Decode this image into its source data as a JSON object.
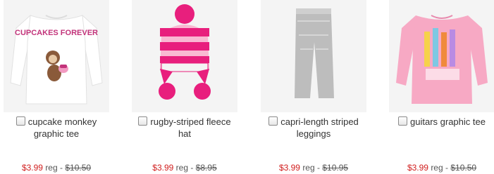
{
  "products": [
    {
      "name": "cupcake monkey graphic tee",
      "sale_price": "$3.99",
      "reg_label": "reg -",
      "reg_price": "$10.50",
      "image": {
        "icon": "white-long-sleeve-tee-monkey-graphic",
        "print_text": "CUPCAKES FOREVER"
      }
    },
    {
      "name": "rugby-striped fleece hat",
      "sale_price": "$3.99",
      "reg_label": "reg -",
      "reg_price": "$8.95",
      "image": {
        "icon": "pink-striped-pompom-hat"
      }
    },
    {
      "name": "capri-length striped leggings",
      "sale_price": "$3.99",
      "reg_label": "reg -",
      "reg_price": "$10.95",
      "image": {
        "icon": "grey-capri-leggings"
      }
    },
    {
      "name": "guitars graphic tee",
      "sale_price": "$3.99",
      "reg_label": "reg -",
      "reg_price": "$10.50",
      "image": {
        "icon": "pink-long-sleeve-tee-guitars-graphic"
      }
    }
  ],
  "colors": {
    "sale": "#d11e1e",
    "text": "#333333",
    "thumb_bg": "#f3f3f3"
  }
}
